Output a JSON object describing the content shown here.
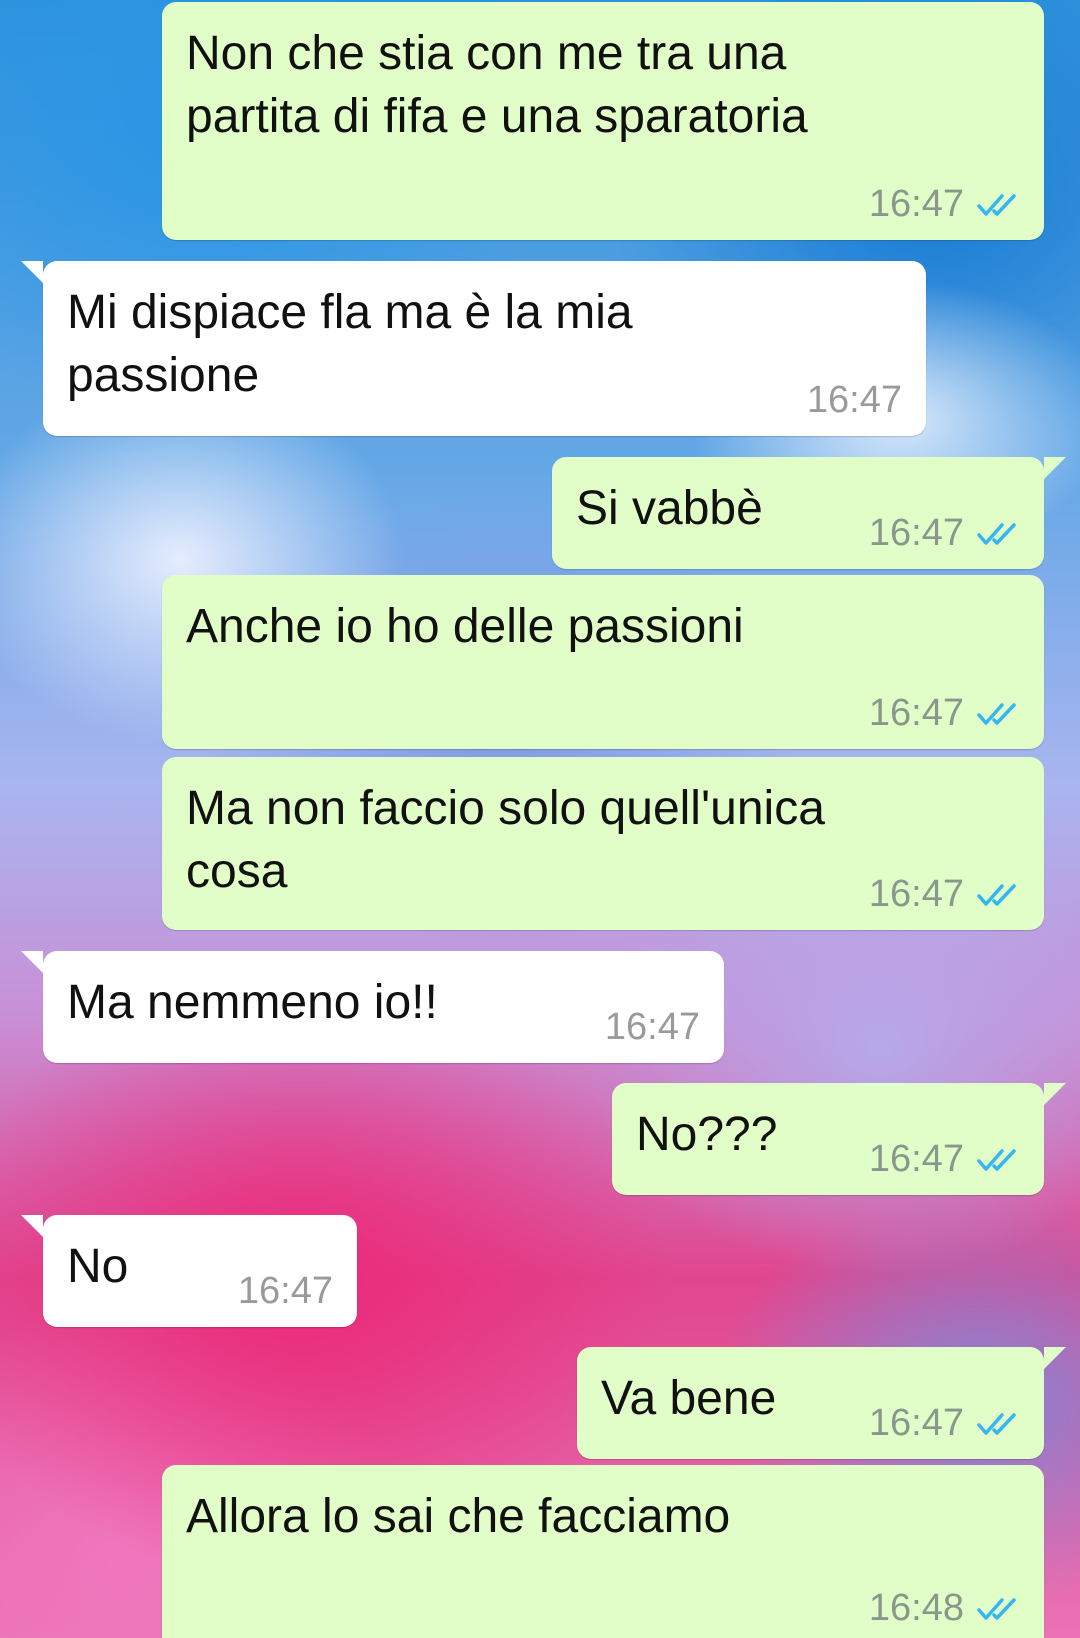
{
  "messages": [
    {
      "direction": "out",
      "text": "Non che stia con me tra una\npartita di fifa e una sparatoria",
      "time": "16:47",
      "status_icon": "double-check-read-icon"
    },
    {
      "direction": "in",
      "text": "Mi dispiace fla ma è la mia\npassione",
      "time": "16:47"
    },
    {
      "direction": "out",
      "text": "Si vabbè",
      "time": "16:47",
      "status_icon": "double-check-read-icon"
    },
    {
      "direction": "out",
      "text": "Anche io ho delle passioni",
      "time": "16:47",
      "status_icon": "double-check-read-icon"
    },
    {
      "direction": "out",
      "text": "Ma non faccio solo quell'unica\ncosa",
      "time": "16:47",
      "status_icon": "double-check-read-icon"
    },
    {
      "direction": "in",
      "text": "Ma nemmeno io!!",
      "time": "16:47"
    },
    {
      "direction": "out",
      "text": "No???",
      "time": "16:47",
      "status_icon": "double-check-read-icon"
    },
    {
      "direction": "in",
      "text": "No",
      "time": "16:47"
    },
    {
      "direction": "out",
      "text": "Va bene",
      "time": "16:47",
      "status_icon": "double-check-read-icon"
    },
    {
      "direction": "out",
      "text": "Allora lo sai che facciamo",
      "time": "16:48",
      "status_icon": "double-check-read-icon"
    }
  ],
  "colors": {
    "outgoing_bubble": "#e2fec8",
    "incoming_bubble": "#ffffff",
    "read_check": "#34b7f1",
    "timestamp": "#8a978c"
  }
}
